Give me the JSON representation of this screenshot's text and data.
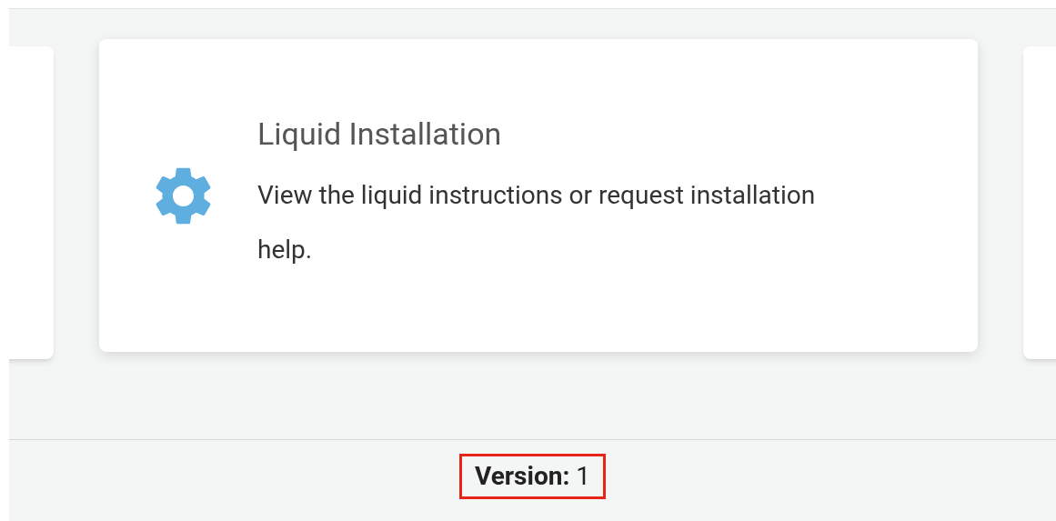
{
  "card": {
    "title": "Liquid Installation",
    "description": "View the liquid instructions or request installation help."
  },
  "footer": {
    "version": "**Version:** 1",
    "highlighted": true
  }
}
